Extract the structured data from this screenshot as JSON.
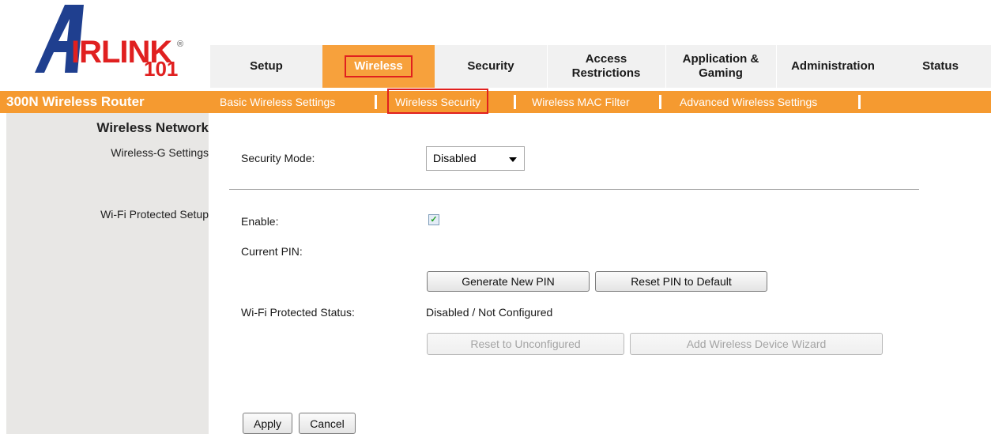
{
  "brand": {
    "logo_text_a": "A",
    "logo_text_rest": "IRLINK",
    "logo_number": "101",
    "logo_registered": "®"
  },
  "nav": {
    "tabs": [
      {
        "label": "Setup"
      },
      {
        "label": "Wireless"
      },
      {
        "label": "Security"
      },
      {
        "label": "Access Restrictions"
      },
      {
        "label": "Application & Gaming"
      },
      {
        "label": "Administration"
      },
      {
        "label": "Status"
      }
    ],
    "active_tab": "Wireless"
  },
  "router_title": "300N Wireless Router",
  "subnav": {
    "items": [
      {
        "label": "Basic Wireless Settings"
      },
      {
        "label": "Wireless Security"
      },
      {
        "label": "Wireless MAC Filter"
      },
      {
        "label": "Advanced Wireless Settings"
      }
    ],
    "active_item": "Wireless Security"
  },
  "sidebar": {
    "heading": "Wireless Network",
    "items": [
      {
        "label": "Wireless-G Settings"
      },
      {
        "label": "Wi-Fi Protected Setup"
      }
    ]
  },
  "form": {
    "security_mode_label": "Security Mode:",
    "security_mode_value": "Disabled",
    "enable_label": "Enable:",
    "enable_checked": true,
    "current_pin_label": "Current PIN:",
    "current_pin_value": "",
    "generate_pin_button": "Generate New PIN",
    "reset_pin_button": "Reset PIN to Default",
    "wps_status_label": "Wi-Fi Protected Status:",
    "wps_status_value": "Disabled / Not Configured",
    "reset_unconfigured_button": "Reset to Unconfigured",
    "add_device_button": "Add Wireless Device Wizard",
    "apply_button": "Apply",
    "cancel_button": "Cancel"
  },
  "colors": {
    "accent_orange": "#f59a30",
    "active_tab": "#f7a13c",
    "highlight_red": "#e0201f",
    "sidebar_bg": "#e8e7e5",
    "logo_red": "#e02020"
  },
  "icons": {
    "dropdown": "chevron-down-icon",
    "checkbox": "checkmark-icon"
  }
}
